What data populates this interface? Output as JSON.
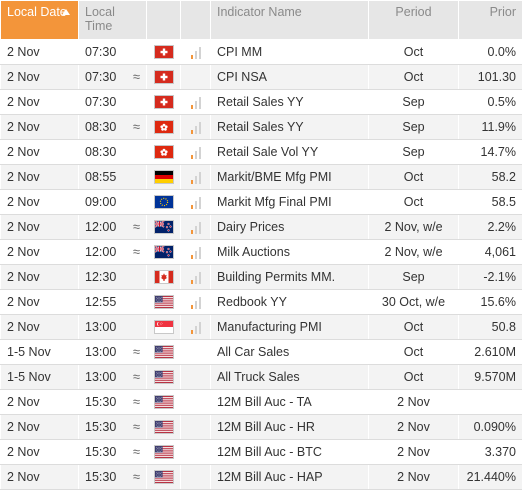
{
  "header": {
    "date": "Local Date",
    "time": "Local Time",
    "indicator": "Indicator Name",
    "period": "Period",
    "prior": "Prior"
  },
  "rows": [
    {
      "date": "2 Nov",
      "time": "07:30",
      "approx": false,
      "flag": "ch",
      "importance": 1,
      "name": "CPI MM",
      "period": "Oct",
      "prior": "0.0%"
    },
    {
      "date": "2 Nov",
      "time": "07:30",
      "approx": true,
      "flag": "ch",
      "importance": 0,
      "name": "CPI NSA",
      "period": "Oct",
      "prior": "101.30"
    },
    {
      "date": "2 Nov",
      "time": "07:30",
      "approx": false,
      "flag": "ch",
      "importance": 1,
      "name": "Retail Sales YY",
      "period": "Sep",
      "prior": "0.5%"
    },
    {
      "date": "2 Nov",
      "time": "08:30",
      "approx": true,
      "flag": "hk",
      "importance": 1,
      "name": "Retail Sales YY",
      "period": "Sep",
      "prior": "11.9%"
    },
    {
      "date": "2 Nov",
      "time": "08:30",
      "approx": false,
      "flag": "hk",
      "importance": 1,
      "name": "Retail Sale Vol YY",
      "period": "Sep",
      "prior": "14.7%"
    },
    {
      "date": "2 Nov",
      "time": "08:55",
      "approx": false,
      "flag": "de",
      "importance": 1,
      "name": "Markit/BME Mfg PMI",
      "period": "Oct",
      "prior": "58.2"
    },
    {
      "date": "2 Nov",
      "time": "09:00",
      "approx": false,
      "flag": "eu",
      "importance": 1,
      "name": "Markit Mfg Final PMI",
      "period": "Oct",
      "prior": "58.5"
    },
    {
      "date": "2 Nov",
      "time": "12:00",
      "approx": true,
      "flag": "nz",
      "importance": 1,
      "name": "Dairy Prices",
      "period": "2 Nov, w/e",
      "prior": "2.2%"
    },
    {
      "date": "2 Nov",
      "time": "12:00",
      "approx": true,
      "flag": "nz",
      "importance": 1,
      "name": "Milk Auctions",
      "period": "2 Nov, w/e",
      "prior": "4,061"
    },
    {
      "date": "2 Nov",
      "time": "12:30",
      "approx": false,
      "flag": "ca",
      "importance": 1,
      "name": "Building Permits MM.",
      "period": "Sep",
      "prior": "-2.1%"
    },
    {
      "date": "2 Nov",
      "time": "12:55",
      "approx": false,
      "flag": "us",
      "importance": 1,
      "name": "Redbook YY",
      "period": "30 Oct, w/e",
      "prior": "15.6%"
    },
    {
      "date": "2 Nov",
      "time": "13:00",
      "approx": false,
      "flag": "sg",
      "importance": 1,
      "name": "Manufacturing PMI",
      "period": "Oct",
      "prior": "50.8"
    },
    {
      "date": "1-5 Nov",
      "time": "13:00",
      "approx": true,
      "flag": "us",
      "importance": 0,
      "name": "All Car Sales",
      "period": "Oct",
      "prior": "2.610M"
    },
    {
      "date": "1-5 Nov",
      "time": "13:00",
      "approx": true,
      "flag": "us",
      "importance": 0,
      "name": "All Truck Sales",
      "period": "Oct",
      "prior": "9.570M"
    },
    {
      "date": "2 Nov",
      "time": "15:30",
      "approx": true,
      "flag": "us",
      "importance": 0,
      "name": "12M Bill Auc - TA",
      "period": "2 Nov",
      "prior": ""
    },
    {
      "date": "2 Nov",
      "time": "15:30",
      "approx": true,
      "flag": "us",
      "importance": 0,
      "name": "12M Bill Auc - HR",
      "period": "2 Nov",
      "prior": "0.090%"
    },
    {
      "date": "2 Nov",
      "time": "15:30",
      "approx": true,
      "flag": "us",
      "importance": 0,
      "name": "12M Bill Auc - BTC",
      "period": "2 Nov",
      "prior": "3.370"
    },
    {
      "date": "2 Nov",
      "time": "15:30",
      "approx": true,
      "flag": "us",
      "importance": 0,
      "name": "12M Bill Auc - HAP",
      "period": "2 Nov",
      "prior": "21.440%"
    }
  ],
  "approx_symbol": "≈",
  "colors": {
    "accent": "#f3953a",
    "header_bg": "#e6e6e6",
    "header_text": "#8a8a8a",
    "row_alt": "#f3f3f3"
  }
}
